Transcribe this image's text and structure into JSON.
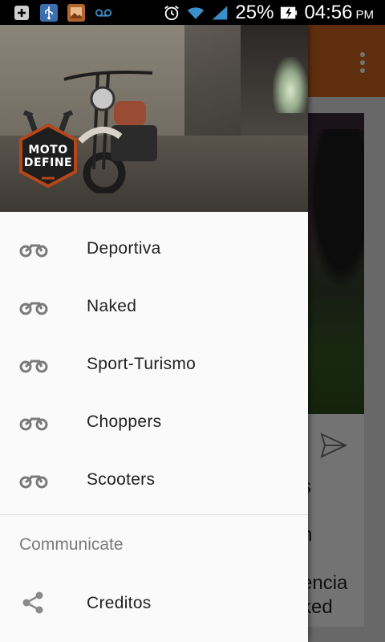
{
  "status_bar": {
    "battery_percent": "25%",
    "time": "04:56",
    "ampm": "PM",
    "icons": [
      "add-box-icon",
      "usb-icon",
      "image-icon",
      "voicemail-icon",
      "alarm-icon",
      "wifi-icon",
      "signal-icon",
      "battery-charging-icon"
    ]
  },
  "app": {
    "toolbar_color": "#d2691e",
    "overflow_icon": "overflow-menu-icon",
    "card_lines": [
      "s",
      "n",
      "encia",
      "ked"
    ],
    "send_icon": "send-icon"
  },
  "drawer": {
    "header_logo_lines": [
      "MOTO",
      "DEFINE"
    ],
    "items": [
      {
        "label": "Deportiva",
        "icon": "motorcycle-icon"
      },
      {
        "label": "Naked",
        "icon": "motorcycle-icon"
      },
      {
        "label": "Sport-Turismo",
        "icon": "motorcycle-icon"
      },
      {
        "label": "Choppers",
        "icon": "motorcycle-icon"
      },
      {
        "label": "Scooters",
        "icon": "motorcycle-icon"
      }
    ],
    "section_title": "Communicate",
    "section_items": [
      {
        "label": "Creditos",
        "icon": "share-icon"
      }
    ]
  }
}
